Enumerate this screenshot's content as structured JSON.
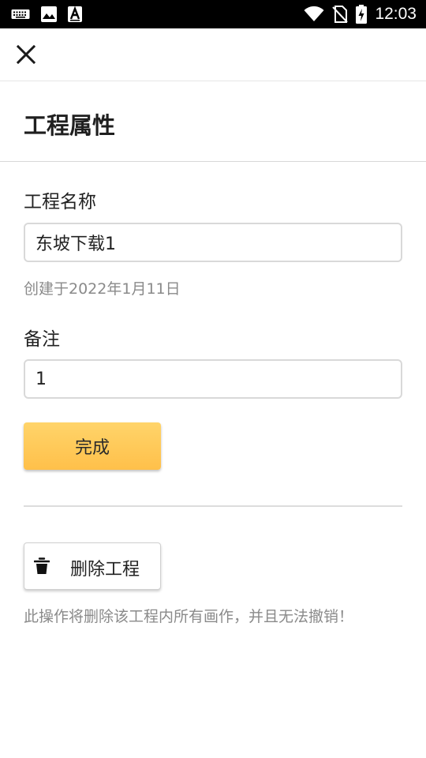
{
  "status_bar": {
    "time": "12:03",
    "left_icons": [
      "keyboard-icon",
      "image-icon",
      "font-a-icon"
    ],
    "right_icons": [
      "wifi-icon",
      "no-sim-icon",
      "battery-charging-icon"
    ]
  },
  "top_bar": {
    "close_icon": "close-icon"
  },
  "page": {
    "title": "工程属性"
  },
  "form": {
    "name_label": "工程名称",
    "name_value": "东坡下载1",
    "created_text": "创建于2022年1月11日",
    "note_label": "备注",
    "note_value": "1",
    "done_label": "完成"
  },
  "danger": {
    "delete_label": "删除工程",
    "delete_icon": "trash-icon",
    "warning": "此操作将删除该工程内所有画作，并且无法撤销！"
  },
  "colors": {
    "status_bar_bg": "#000000",
    "accent_button": "#ffc852",
    "hint_text": "#8a8a8a"
  }
}
